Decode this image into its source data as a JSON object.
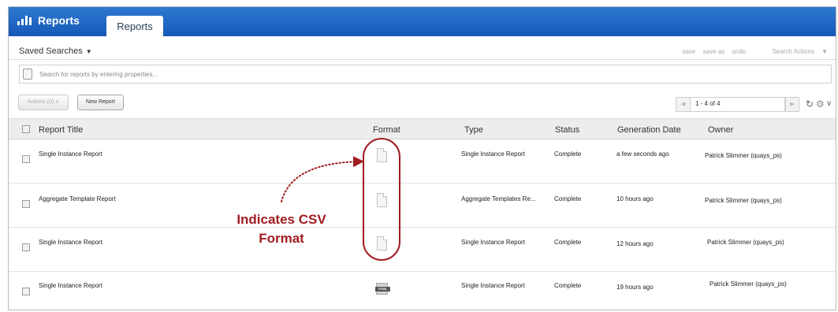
{
  "header": {
    "app_title": "Reports",
    "active_tab": "Reports"
  },
  "saved_searches": {
    "label": "Saved Searches",
    "actions": [
      "save",
      "save as",
      "undo"
    ],
    "search_actions": "Search Actions"
  },
  "search": {
    "placeholder": "Search for reports by entering properties..."
  },
  "toolbar": {
    "actions_label": "Actions (0)",
    "new_report_label": "New Report",
    "pagination": "1 - 4 of 4"
  },
  "table": {
    "columns": [
      "Report Title",
      "Format",
      "Type",
      "Status",
      "Generation Date",
      "Owner"
    ],
    "rows": [
      {
        "title": "Single Instance Report",
        "format": "csv",
        "type": "Single Instance Report",
        "status": "Complete",
        "generated": "a few seconds ago",
        "owner": "Patrick Slimmer (quays_ps)"
      },
      {
        "title": "Aggregate Template Report",
        "format": "csv",
        "type": "Aggregate Templates Re...",
        "status": "Complete",
        "generated": "10 hours ago",
        "owner": "Patrick Slimmer (quays_ps)"
      },
      {
        "title": "Single Instance Report",
        "format": "csv",
        "type": "Single Instance Report",
        "status": "Complete",
        "generated": "12 hours ago",
        "owner": "Patrick Slimmer (quays_ps)"
      },
      {
        "title": "Single Instance Report",
        "format": "html",
        "type": "Single Instance Report",
        "status": "Complete",
        "generated": "19 hours ago",
        "owner": "Patrick Slimmer (quays_ps)"
      }
    ]
  },
  "html_icon_text": "HTML",
  "annotation": {
    "line1": "Indicates CSV",
    "line2": "Format",
    "color": "#a01d22"
  },
  "colors": {
    "header_blue": "#1f66c4"
  }
}
